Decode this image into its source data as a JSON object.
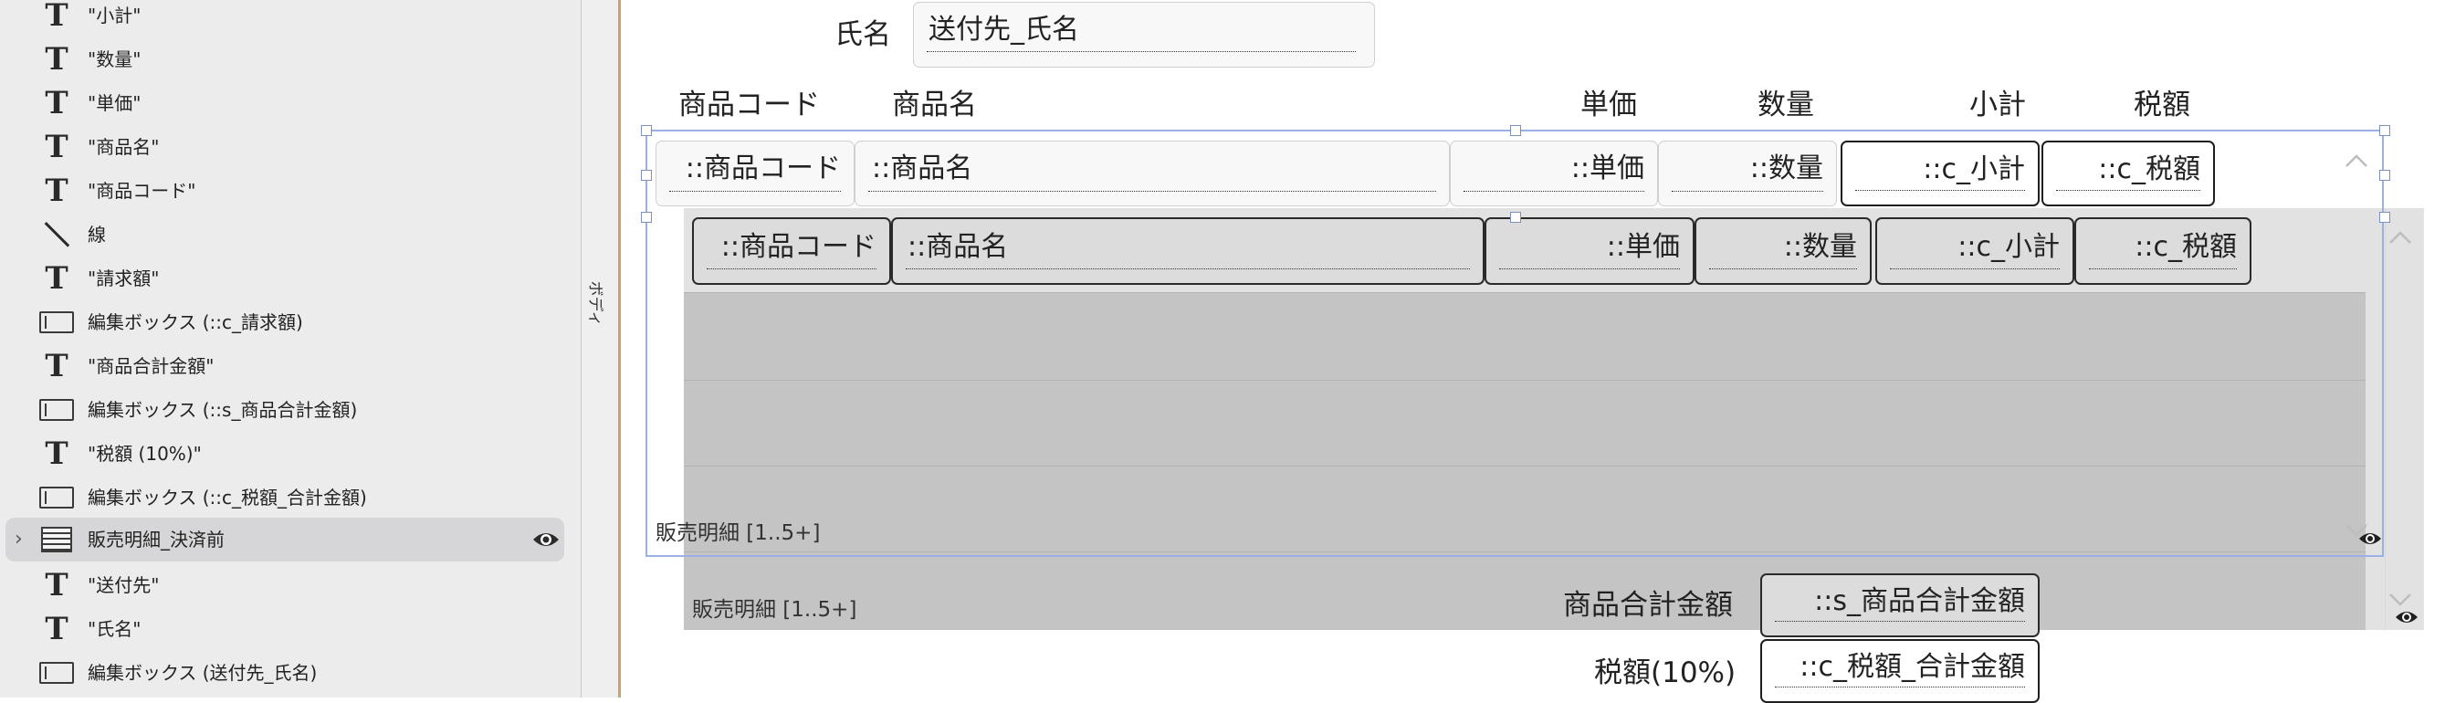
{
  "sidebar": {
    "items": [
      {
        "icon": "text-icon",
        "label": "\"小計\""
      },
      {
        "icon": "text-icon",
        "label": "\"数量\""
      },
      {
        "icon": "text-icon",
        "label": "\"単価\""
      },
      {
        "icon": "text-icon",
        "label": "\"商品名\""
      },
      {
        "icon": "text-icon",
        "label": "\"商品コード\""
      },
      {
        "icon": "line-icon",
        "label": "線"
      },
      {
        "icon": "text-icon",
        "label": "\"請求額\""
      },
      {
        "icon": "edit-box-icon",
        "label": "編集ボックス (::c_請求額)"
      },
      {
        "icon": "text-icon",
        "label": "\"商品合計金額\""
      },
      {
        "icon": "edit-box-icon",
        "label": "編集ボックス (::s_商品合計金額)"
      },
      {
        "icon": "text-icon",
        "label": "\"税額 (10%)\""
      },
      {
        "icon": "edit-box-icon",
        "label": "編集ボックス (::c_税額_合計金額)"
      },
      {
        "icon": "portal-icon",
        "label": "販売明細_決済前",
        "selected": true
      },
      {
        "icon": "text-icon",
        "label": "\"送付先\""
      },
      {
        "icon": "text-icon",
        "label": "\"氏名\""
      },
      {
        "icon": "edit-box-icon",
        "label": "編集ボックス (送付先_氏名)"
      }
    ],
    "expand_glyph": "›"
  },
  "band": {
    "label": "ボディ"
  },
  "canvas": {
    "name_label": "氏名",
    "name_field": "送付先_氏名",
    "headers": {
      "code": "商品コード",
      "name": "商品名",
      "price": "単価",
      "qty": "数量",
      "subtotal": "小計",
      "tax": "税額"
    },
    "row1": {
      "code": "::商品コード",
      "name": "::商品名",
      "price": "::単価",
      "qty": "::数量",
      "subtotal": "::c_小計",
      "tax": "::c_税額"
    },
    "row2": {
      "code": "::商品コード",
      "name": "::商品名",
      "price": "::単価",
      "qty": "::数量",
      "subtotal": "::c_小計",
      "tax": "::c_税額"
    },
    "inner_portal_label": "販売明細 [1..5+]",
    "outer_portal_label": "販売明細 [1..5+]",
    "total_label": "商品合計金額",
    "total_field": "::s_商品合計金額",
    "tax_total_label": "税額(10%)",
    "tax_total_field": "::c_税額_合計金額"
  },
  "colors": {
    "selection": "#9ab0e6",
    "band_divider": "#c8a36a",
    "portal_row": "#c4c4c4",
    "portal_outer": "#e2e2e2"
  }
}
